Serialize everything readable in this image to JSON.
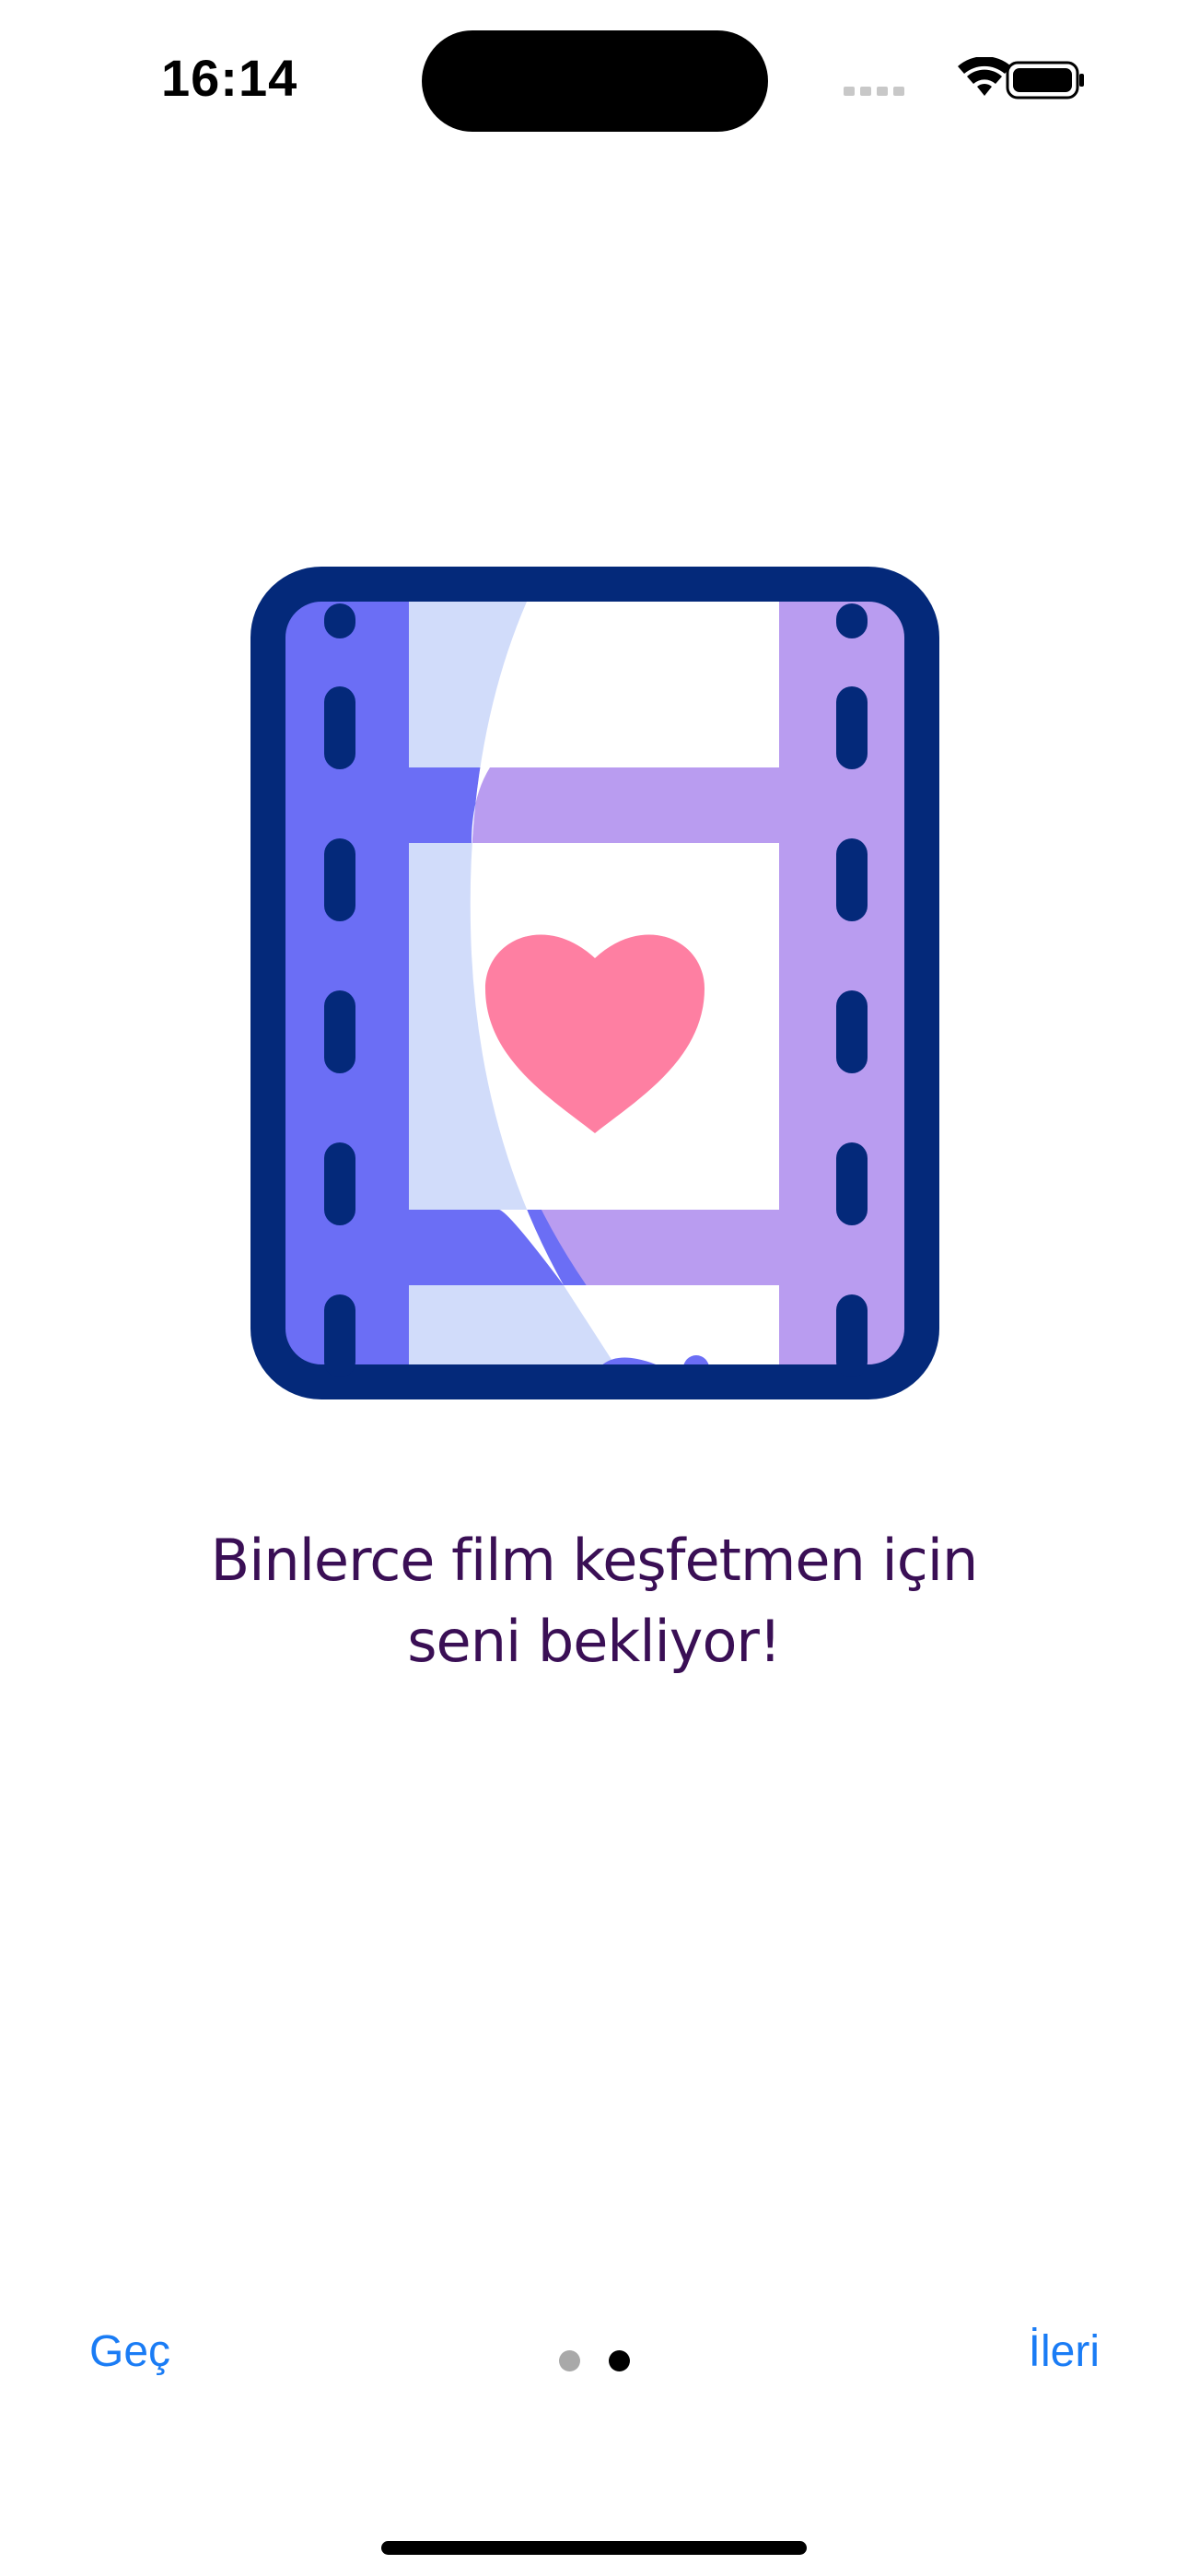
{
  "status_bar": {
    "time": "16:14",
    "icons": [
      "cellular-signal-icon",
      "wifi-icon",
      "battery-icon"
    ]
  },
  "illustration": {
    "icon": "film-strip-heart-icon"
  },
  "onboarding": {
    "message_line_1": "Binlerce film keşfetmen için",
    "message_line_2": "seni bekliyor!"
  },
  "navigation": {
    "skip_label": "Geç",
    "next_label": "İleri",
    "total_pages": 2,
    "current_page": 2
  },
  "colors": {
    "text": "#3a0f55",
    "link": "#1a7cf5",
    "film_outline": "#04297a",
    "film_left_strip": "#6b6ef5",
    "film_right_strip": "#b99cf0",
    "film_frame_tint": "#d1dcfa",
    "heart": "#fe7fa2",
    "dot_inactive": "#a9a9a9",
    "dot_active": "#000000"
  }
}
